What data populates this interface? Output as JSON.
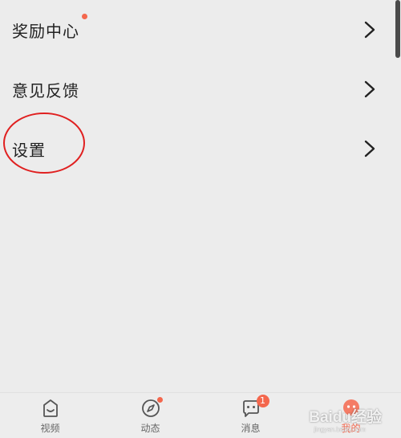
{
  "menu": {
    "items": [
      {
        "label": "奖励中心",
        "has_dot": true,
        "chevron": "chevron-right-icon"
      },
      {
        "label": "意见反馈",
        "has_dot": false,
        "chevron": "chevron-right-icon"
      },
      {
        "label": "设置",
        "has_dot": false,
        "chevron": "chevron-right-icon"
      }
    ]
  },
  "annotation": {
    "color": "#e02020",
    "target": "设置"
  },
  "tabbar": {
    "tabs": [
      {
        "label": "视频",
        "icon": "tv-icon",
        "active": false
      },
      {
        "label": "动态",
        "icon": "compass-icon",
        "active": false,
        "dot": true
      },
      {
        "label": "消息",
        "icon": "chat-bubble-icon",
        "active": false,
        "badge": "1"
      },
      {
        "label": "我的",
        "icon": "profile-icon",
        "active": true
      }
    ]
  },
  "watermark": {
    "text": "Baidu经验",
    "sub": "jingyan.baidu.com"
  },
  "colors": {
    "accent": "#f4674d",
    "background": "#ececec",
    "text": "#222222"
  }
}
